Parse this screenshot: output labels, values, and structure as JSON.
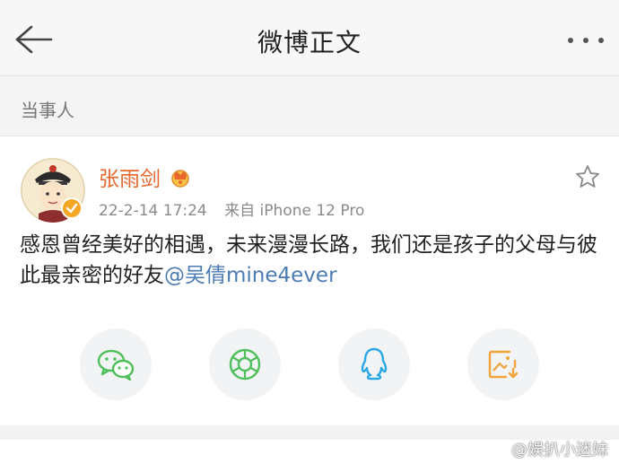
{
  "header": {
    "title": "微博正文"
  },
  "section": {
    "label": "当事人"
  },
  "post": {
    "username": "张雨剑",
    "date": "22-2-14 17:24",
    "source": "来自 iPhone 12 Pro",
    "text_main": "感恩曾经美好的相遇，未来漫漫长路，我们还是孩子的父母与彼此最亲密的好友",
    "mention": "@吴倩mine4ever"
  },
  "share": {
    "icons": [
      "wechat-icon",
      "moments-icon",
      "qq-icon",
      "save-image-icon"
    ]
  },
  "watermark": {
    "text": "@娱扒小迷妹"
  },
  "colors": {
    "username": "#e8672c",
    "mention": "#4b7bb3",
    "wechat": "#4fbf5b",
    "qq": "#2aa7e6",
    "save": "#f0a43a"
  }
}
